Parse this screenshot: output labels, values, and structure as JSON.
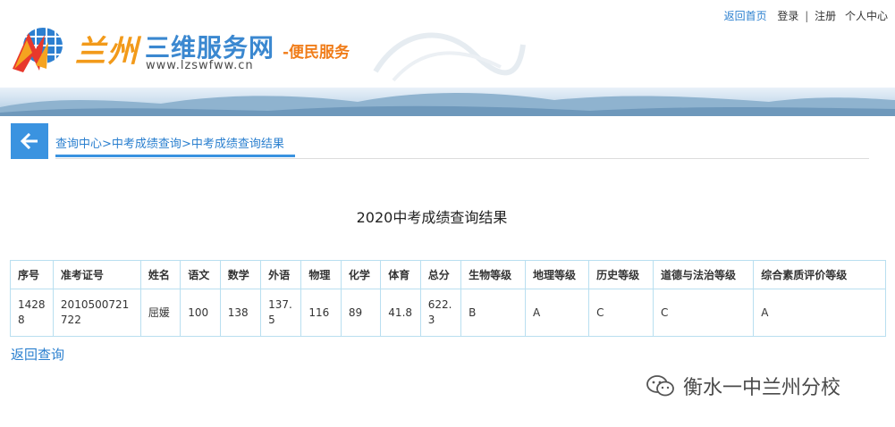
{
  "site": {
    "logo_lan": "兰州",
    "logo_name": "三维服务网",
    "logo_url": "www.lzswfww.cn",
    "logo_slogan": "-便民服务"
  },
  "topnav": {
    "home": "返回首页",
    "login": "登录",
    "divider": "|",
    "register": "注册",
    "user_center": "个人中心"
  },
  "breadcrumb": {
    "items": [
      "查询中心",
      "中考成绩查询",
      "中考成绩查询结果"
    ],
    "separator": ">"
  },
  "result_title": "2020中考成绩查询结果",
  "table": {
    "headers": [
      "序号",
      "准考证号",
      "姓名",
      "语文",
      "数学",
      "外语",
      "物理",
      "化学",
      "体育",
      "总分",
      "生物等级",
      "地理等级",
      "历史等级",
      "道德与法治等级",
      "综合素质评价等级"
    ],
    "rows": [
      [
        "14288",
        "2010500721722",
        "屈媛",
        "100",
        "138",
        "137.5",
        "116",
        "89",
        "41.8",
        "622.3",
        "B",
        "A",
        "C",
        "C",
        "A"
      ]
    ]
  },
  "back_query": "返回查询",
  "watermark": "衡水一中兰州分校",
  "colors": {
    "accent": "#3a93e0",
    "link": "#2a7fcf",
    "table_border": "#b9dff0",
    "slogan": "#f07d1a"
  },
  "icons": {
    "back": "arrow-left-icon",
    "logo": "globe-logo-icon",
    "watermark": "wechat-icon"
  }
}
